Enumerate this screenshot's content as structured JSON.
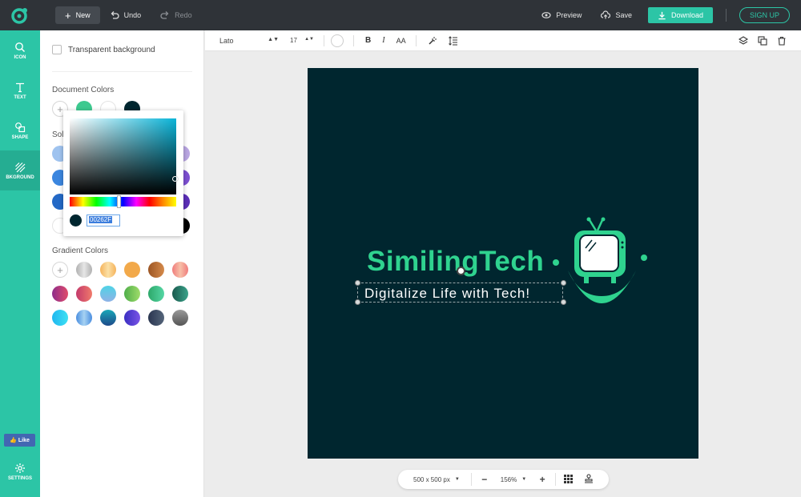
{
  "topbar": {
    "new_label": "New",
    "undo_label": "Undo",
    "redo_label": "Redo",
    "preview_label": "Preview",
    "save_label": "Save",
    "download_label": "Download",
    "signup_label": "SIGN UP"
  },
  "rail": {
    "items": [
      {
        "label": "ICON",
        "icon": "search-icon"
      },
      {
        "label": "TEXT",
        "icon": "text-icon"
      },
      {
        "label": "SHAPE",
        "icon": "shape-icon"
      },
      {
        "label": "BKGROUND",
        "icon": "background-icon",
        "active": true
      }
    ],
    "like_label": "Like",
    "settings_label": "SETTINGS"
  },
  "panel": {
    "transparent_label": "Transparent background",
    "document_colors_title": "Document Colors",
    "solid_colors_title": "Solid Colors",
    "solid_colors_visible": "Sol",
    "gradient_colors_title": "Gradient Colors",
    "document_colors": [
      "#3dc98f",
      "#ffffff",
      "#00262f"
    ],
    "solid_colors_left": [
      "#9fc3ef",
      "#3b86df",
      "#2469c6",
      "#ffffff"
    ],
    "solid_colors_right": [
      "#b9a6e2",
      "#7c4fd1",
      "#5b2fb8",
      "#000000"
    ],
    "gradient_rows": [
      [
        "#c8c8c8",
        "#f7c27a",
        "#f2a94a",
        "#b96a2e",
        "#f09a8f"
      ],
      [
        "#b53a7a",
        "#e0536f",
        "#4fb8d6",
        "#6dc25a",
        "#3fbb82",
        "#2a7b6a"
      ],
      [
        "#29c7f0",
        "#5aa0e6",
        "#1f6f9b",
        "#5b3fd2",
        "#3a4b66",
        "#7d7d7d"
      ]
    ]
  },
  "picker": {
    "hex_value": "00262F",
    "current_color": "#00262f"
  },
  "toolbar": {
    "font_name": "Lato",
    "font_size": "17",
    "bold_label": "B",
    "italic_label": "I",
    "case_label": "AA"
  },
  "canvas": {
    "background": "#00262f",
    "title": "SimilingTech",
    "tagline": "Digitalize Life with Tech!",
    "accent": "#2fd38f"
  },
  "zoombar": {
    "size_label": "500 x 500 px",
    "zoom_label": "156%",
    "minus_label": "−",
    "plus_label": "+"
  }
}
